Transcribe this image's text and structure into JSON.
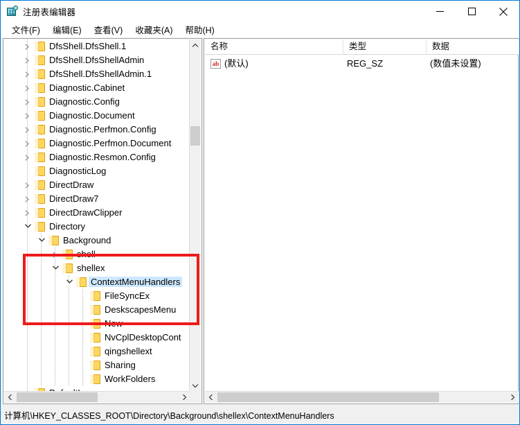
{
  "window": {
    "title": "注册表编辑器",
    "icon": "registry-editor-icon",
    "minimize_label": "–",
    "maximize_label": "□",
    "close_label": "✕"
  },
  "menu": {
    "items": [
      {
        "label": "文件(F)"
      },
      {
        "label": "编辑(E)"
      },
      {
        "label": "查看(V)"
      },
      {
        "label": "收藏夹(A)"
      },
      {
        "label": "帮助(H)"
      }
    ]
  },
  "tree": {
    "nodes": [
      {
        "label": "DfsShell.DfsShell.1",
        "depth": 1,
        "expander": "collapsed"
      },
      {
        "label": "DfsShell.DfsShellAdmin",
        "depth": 1,
        "expander": "collapsed"
      },
      {
        "label": "DfsShell.DfsShellAdmin.1",
        "depth": 1,
        "expander": "collapsed"
      },
      {
        "label": "Diagnostic.Cabinet",
        "depth": 1,
        "expander": "collapsed"
      },
      {
        "label": "Diagnostic.Config",
        "depth": 1,
        "expander": "collapsed"
      },
      {
        "label": "Diagnostic.Document",
        "depth": 1,
        "expander": "collapsed"
      },
      {
        "label": "Diagnostic.Perfmon.Config",
        "depth": 1,
        "expander": "collapsed"
      },
      {
        "label": "Diagnostic.Perfmon.Document",
        "depth": 1,
        "expander": "collapsed"
      },
      {
        "label": "Diagnostic.Resmon.Config",
        "depth": 1,
        "expander": "collapsed"
      },
      {
        "label": "DiagnosticLog",
        "depth": 1,
        "expander": "none"
      },
      {
        "label": "DirectDraw",
        "depth": 1,
        "expander": "collapsed"
      },
      {
        "label": "DirectDraw7",
        "depth": 1,
        "expander": "collapsed"
      },
      {
        "label": "DirectDrawClipper",
        "depth": 1,
        "expander": "collapsed"
      },
      {
        "label": "Directory",
        "depth": 1,
        "expander": "expanded"
      },
      {
        "label": "Background",
        "depth": 2,
        "expander": "expanded"
      },
      {
        "label": "shell",
        "depth": 3,
        "expander": "collapsed"
      },
      {
        "label": "shellex",
        "depth": 3,
        "expander": "expanded"
      },
      {
        "label": "ContextMenuHandlers",
        "depth": 4,
        "expander": "expanded",
        "selected": true
      },
      {
        "label": "FileSyncEx",
        "depth": 5,
        "expander": "none"
      },
      {
        "label": "DeskscapesMenu",
        "depth": 5,
        "expander": "none"
      },
      {
        "label": "New",
        "depth": 5,
        "expander": "none"
      },
      {
        "label": "NvCplDesktopCont",
        "depth": 5,
        "expander": "none"
      },
      {
        "label": "qingshellext",
        "depth": 5,
        "expander": "none"
      },
      {
        "label": "Sharing",
        "depth": 5,
        "expander": "none"
      },
      {
        "label": "WorkFolders",
        "depth": 5,
        "expander": "none"
      },
      {
        "label": "DefaultIcon",
        "depth": 1,
        "expander": "none"
      }
    ],
    "highlight_color": "#ee1b1b",
    "selection_color": "#cde8ff"
  },
  "list": {
    "columns": [
      {
        "label": "名称"
      },
      {
        "label": "类型"
      },
      {
        "label": "数据"
      }
    ],
    "rows": [
      {
        "icon": "string-value-icon",
        "name": "(默认)",
        "type": "REG_SZ",
        "data": "(数值未设置)"
      }
    ]
  },
  "status": {
    "path": "计算机\\HKEY_CLASSES_ROOT\\Directory\\Background\\shellex\\ContextMenuHandlers"
  },
  "scrollbars": {
    "tree_vertical": {
      "up": "▲",
      "down": "▼"
    },
    "tree_horizontal": {
      "left": "◀",
      "right": "▶"
    },
    "list_horizontal": {
      "left": "◀",
      "right": "▶"
    }
  }
}
